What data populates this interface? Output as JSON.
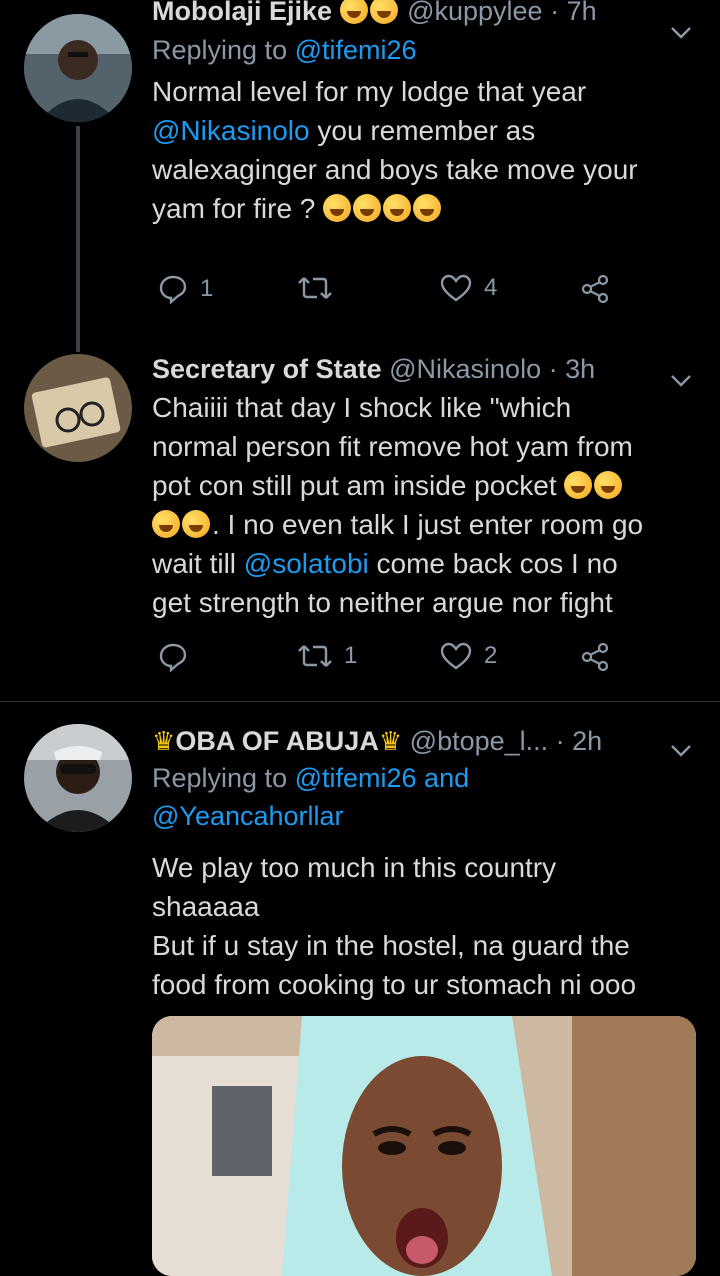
{
  "tweets": [
    {
      "name": "Mobolaji Ejike",
      "handle": "@kuppylee",
      "time": "· 7h",
      "replying_prefix": "Replying to",
      "replying_to": "@tifemi26",
      "body_line1": "Normal level for my lodge that year",
      "body_mention": "@Nikasinolo",
      "body_line2_rest": " you remember as",
      "body_line3": "walexaginger and boys take move your",
      "body_line4": "yam for fire ?",
      "replies": "1",
      "retweets": "",
      "likes": "4"
    },
    {
      "name": "Secretary of State",
      "handle": "@Nikasinolo",
      "time": "· 3h",
      "body_line1": "Chaiiii that day I shock like \"which",
      "body_line2": "normal person fit remove hot yam from",
      "body_line3": "pot con still put am inside pocket",
      "body_line4_rest": ". I no even talk I just enter room go",
      "body_line5_prefix": "wait till ",
      "body_mention": "@solatobi",
      "body_line5_rest": " come back cos I no",
      "body_line6": "get strength to neither argue nor fight",
      "replies": "",
      "retweets": "1",
      "likes": "2"
    },
    {
      "name": "OBA OF ABUJA",
      "handle": "@btope_l...",
      "time": "· 2h",
      "replying_prefix": "Replying to",
      "replying_to": "@tifemi26 and",
      "replying_to2": "@Yeancahorllar",
      "body_line1": "We play too much in this country",
      "body_line2": "shaaaaa",
      "body_line3": "But if u stay in the hostel, na guard the",
      "body_line4": "food from cooking to ur stomach ni ooo"
    }
  ],
  "icons": {
    "reply": "reply-icon",
    "retweet": "retweet-icon",
    "like": "heart-icon",
    "share": "share-icon",
    "more": "chevron-down-icon"
  },
  "colors": {
    "background": "#000000",
    "text": "#d9d9d9",
    "muted": "#8b98a5",
    "link": "#1d9bf0",
    "divider": "#2f3336"
  }
}
